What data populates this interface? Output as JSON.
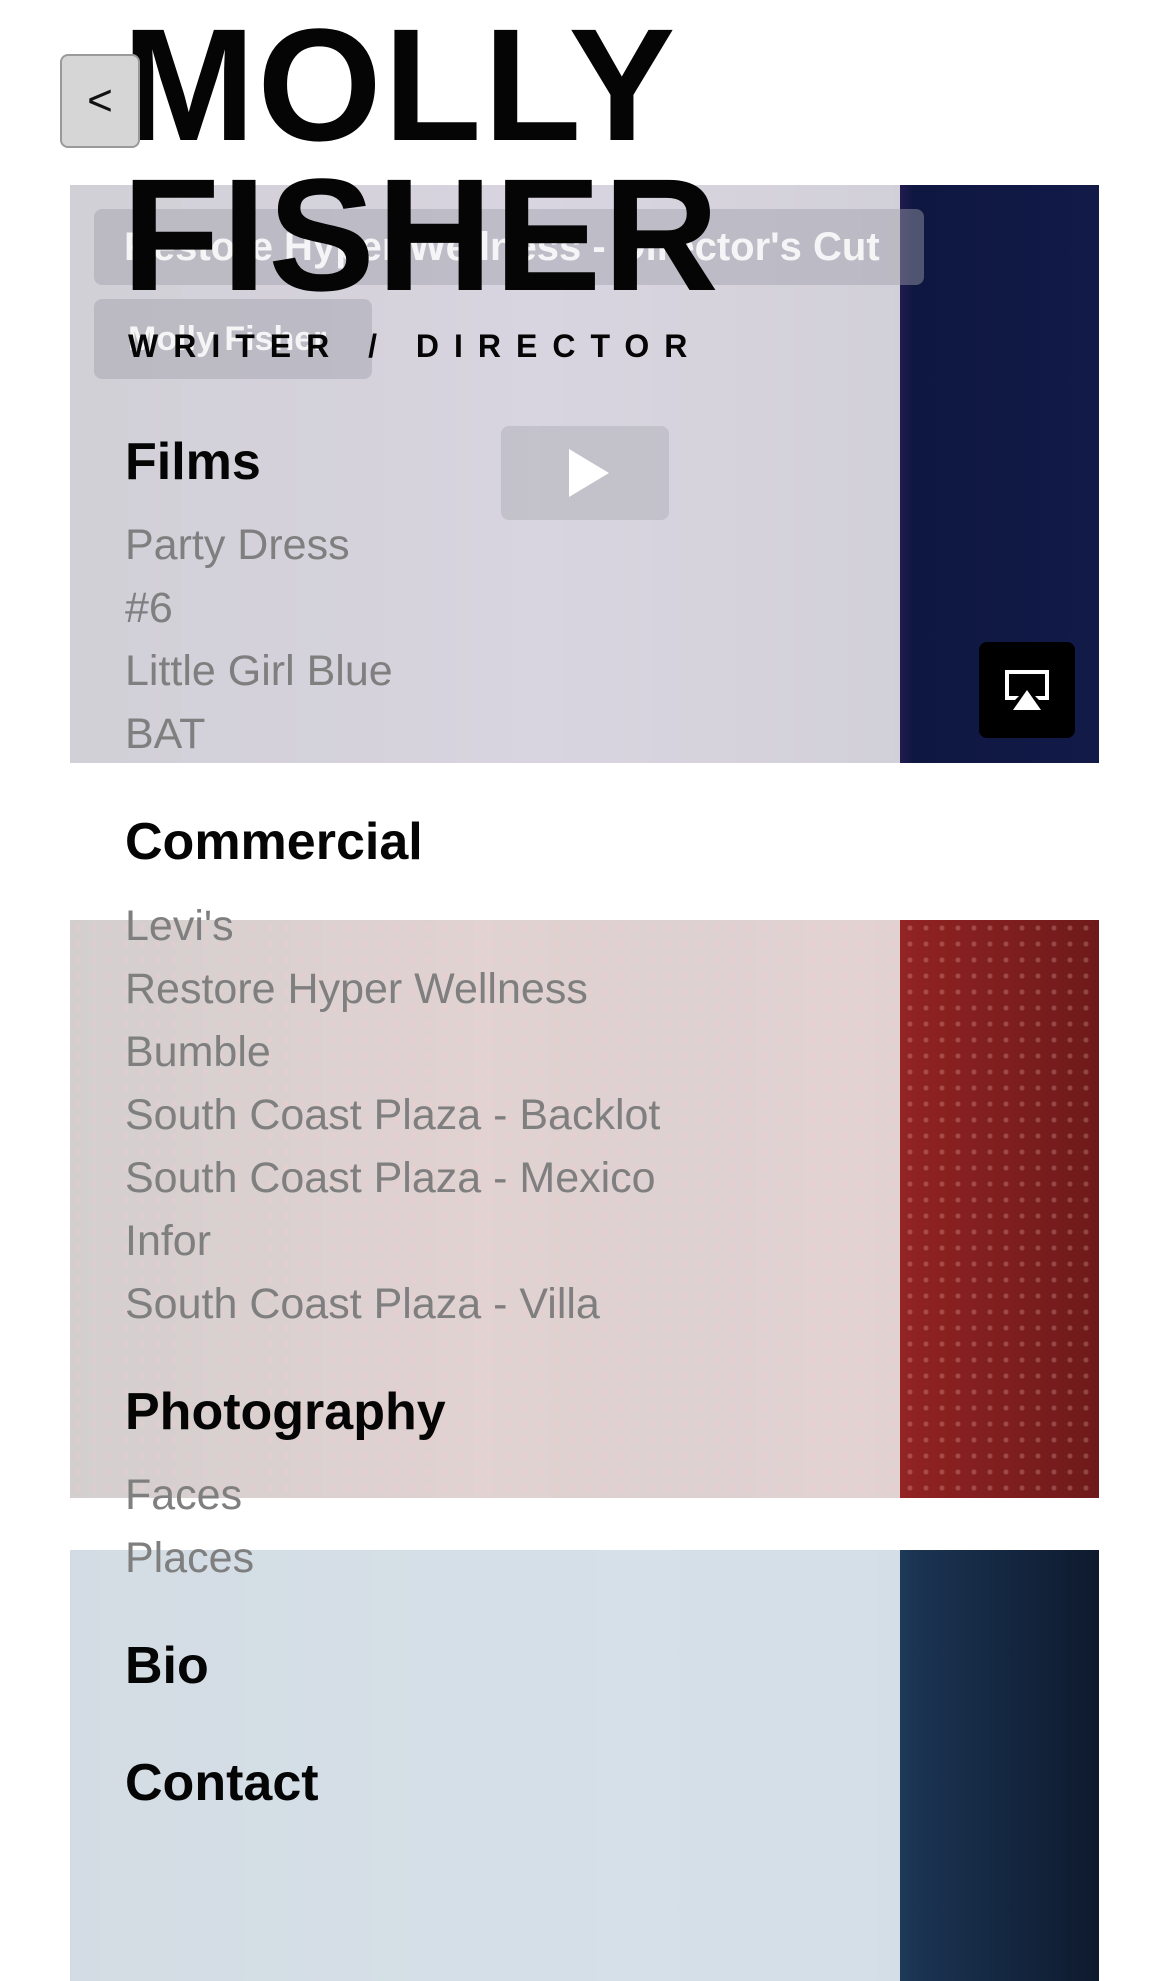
{
  "header": {
    "back_label": "<",
    "title": "MOLLY\nFISHER",
    "subtitle": "WRITER / DIRECTOR"
  },
  "video": {
    "title": "Restore Hyper Wellness - Director's Cut",
    "author": "Molly Fisher"
  },
  "nav": {
    "films": {
      "heading": "Films",
      "items": [
        "Party Dress",
        "#6",
        "Little Girl Blue",
        "BAT"
      ]
    },
    "commercial": {
      "heading": "Commercial",
      "items": [
        "Levi's",
        "Restore Hyper Wellness",
        "Bumble",
        "South Coast Plaza - Backlot",
        "South Coast Plaza - Mexico",
        "Infor",
        "South Coast Plaza - Villa"
      ]
    },
    "photography": {
      "heading": "Photography",
      "items": [
        "Faces",
        "Places"
      ]
    },
    "bio": {
      "heading": "Bio"
    },
    "contact": {
      "heading": "Contact"
    }
  },
  "icons": {
    "back": "chevron-left-icon",
    "play": "play-icon",
    "airplay": "airplay-icon"
  }
}
